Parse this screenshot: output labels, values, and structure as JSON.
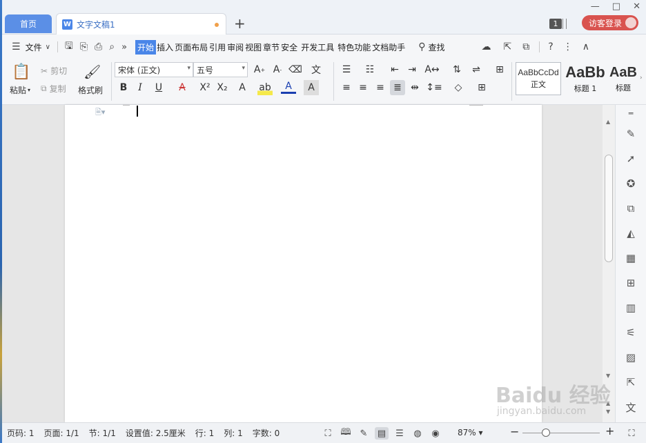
{
  "titlebar": {
    "home_tab": "首页",
    "doc_tab": "文字文稿1",
    "new_tab": "+",
    "page_badge": "1",
    "login": "访客登录",
    "controls": [
      "—",
      "□",
      "✕"
    ]
  },
  "menubar": {
    "file": "文件",
    "tabs": [
      "开始",
      "插入",
      "页面布局",
      "引用",
      "审阅",
      "视图",
      "章节",
      "安全",
      "开发工具",
      "特色功能",
      "文档助手"
    ],
    "active_tab": "开始",
    "search": "查找"
  },
  "ribbon": {
    "paste": "粘贴",
    "cut": "剪切",
    "copy": "复制",
    "format_painter": "格式刷",
    "font_name": "宋体 (正文)",
    "font_size": "五号",
    "bold": "B",
    "italic": "I",
    "underline": "U",
    "styles": [
      {
        "sample": "AaBbCcDd",
        "label": "正文"
      },
      {
        "sample": "AaBb",
        "label": "标题 1"
      },
      {
        "sample": "AaB",
        "label": "标题"
      }
    ]
  },
  "statusbar": {
    "page_no": "页码: 1",
    "pages": "页面: 1/1",
    "section": "节: 1/1",
    "setting": "设置值: 2.5厘米",
    "row": "行: 1",
    "col": "列: 1",
    "word_count": "字数: 0",
    "zoom": "87%",
    "zoom_fraction": 0.3
  },
  "watermark": {
    "text": "Baidu 经验",
    "url": "jingyan.baidu.com"
  },
  "colors": {
    "accent": "#4a86e8",
    "login": "#d9534f",
    "unsaved_dot": "#f0a04a"
  }
}
